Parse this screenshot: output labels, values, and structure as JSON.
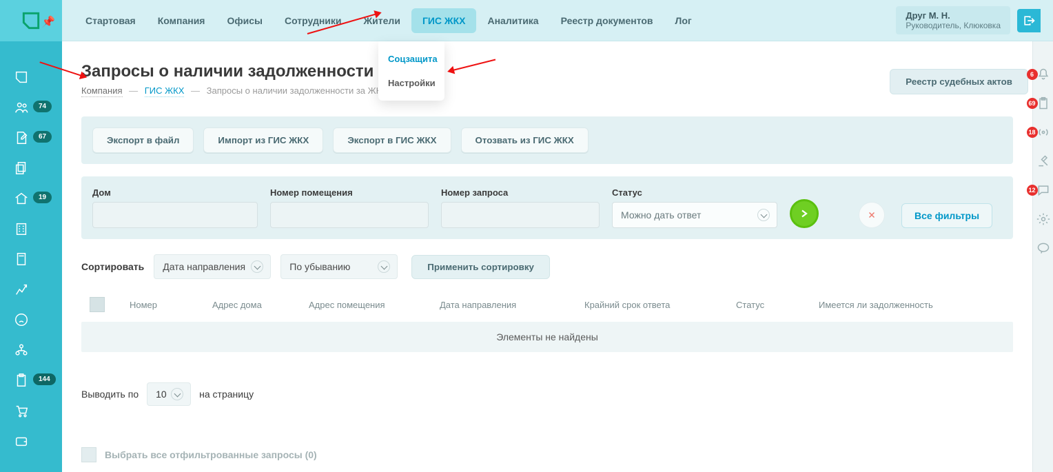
{
  "sidebar": {
    "items": [
      {
        "icon": "logo-box",
        "badge": null
      },
      {
        "icon": "people",
        "badge": "74"
      },
      {
        "icon": "edit-doc",
        "badge": "67"
      },
      {
        "icon": "copy-doc",
        "badge": null
      },
      {
        "icon": "house",
        "badge": "19"
      },
      {
        "icon": "building",
        "badge": null
      },
      {
        "icon": "calculator",
        "badge": null
      },
      {
        "icon": "chart",
        "badge": null
      },
      {
        "icon": "sad-face",
        "badge": null
      },
      {
        "icon": "org",
        "badge": null
      },
      {
        "icon": "clipboard",
        "badge": "144"
      },
      {
        "icon": "cart",
        "badge": null
      },
      {
        "icon": "wallet",
        "badge": null
      }
    ]
  },
  "topnav": {
    "items": [
      "Стартовая",
      "Компания",
      "Офисы",
      "Сотрудники",
      "Жители",
      "ГИС ЖКХ",
      "Аналитика",
      "Реестр документов",
      "Лог"
    ],
    "active_index": 5
  },
  "dropdown": {
    "items": [
      "Соцзащита",
      "Настройки"
    ],
    "selected_index": 0
  },
  "user": {
    "name": "Друг М. Н.",
    "role": "Руководитель, Клюковка"
  },
  "page": {
    "title": "Запросы о наличии задолженности за ЖКУ",
    "title_clipped": "Запросы о наличии задолженности за Ж",
    "breadcrumb": {
      "company": "Компания",
      "gis": "ГИС ЖКХ",
      "current": "Запросы о наличии задолженности за ЖКУ"
    },
    "right_button": "Реестр судебных актов",
    "actions": [
      "Экспорт в файл",
      "Импорт из ГИС ЖКХ",
      "Экспорт в ГИС ЖКХ",
      "Отозвать из ГИС ЖКХ"
    ],
    "filters": {
      "house_label": "Дом",
      "room_label": "Номер помещения",
      "req_label": "Номер запроса",
      "status_label": "Статус",
      "status_value": "Можно дать ответ",
      "all_filters": "Все фильтры"
    },
    "sort": {
      "label": "Сортировать",
      "field": "Дата направления",
      "dir": "По убыванию",
      "apply": "Применить сортировку"
    },
    "table": {
      "cols": [
        "Номер",
        "Адрес дома",
        "Адрес помещения",
        "Дата направления",
        "Крайний срок ответа",
        "Статус",
        "Имеется ли задолженность"
      ],
      "empty": "Элементы не найдены"
    },
    "pager": {
      "prefix": "Выводить по",
      "value": "10",
      "suffix": "на страницу"
    },
    "bulk": {
      "label": "Выбрать все отфильтрованные запросы (0)"
    }
  },
  "rail": {
    "items": [
      {
        "icon": "bell",
        "badge": "6"
      },
      {
        "icon": "clipboard2",
        "badge": "69"
      },
      {
        "icon": "broadcast",
        "badge": "18"
      },
      {
        "icon": "auction",
        "badge": null
      },
      {
        "icon": "chat",
        "badge": "12"
      },
      {
        "icon": "gear",
        "badge": null
      },
      {
        "icon": "message",
        "badge": null
      }
    ]
  }
}
